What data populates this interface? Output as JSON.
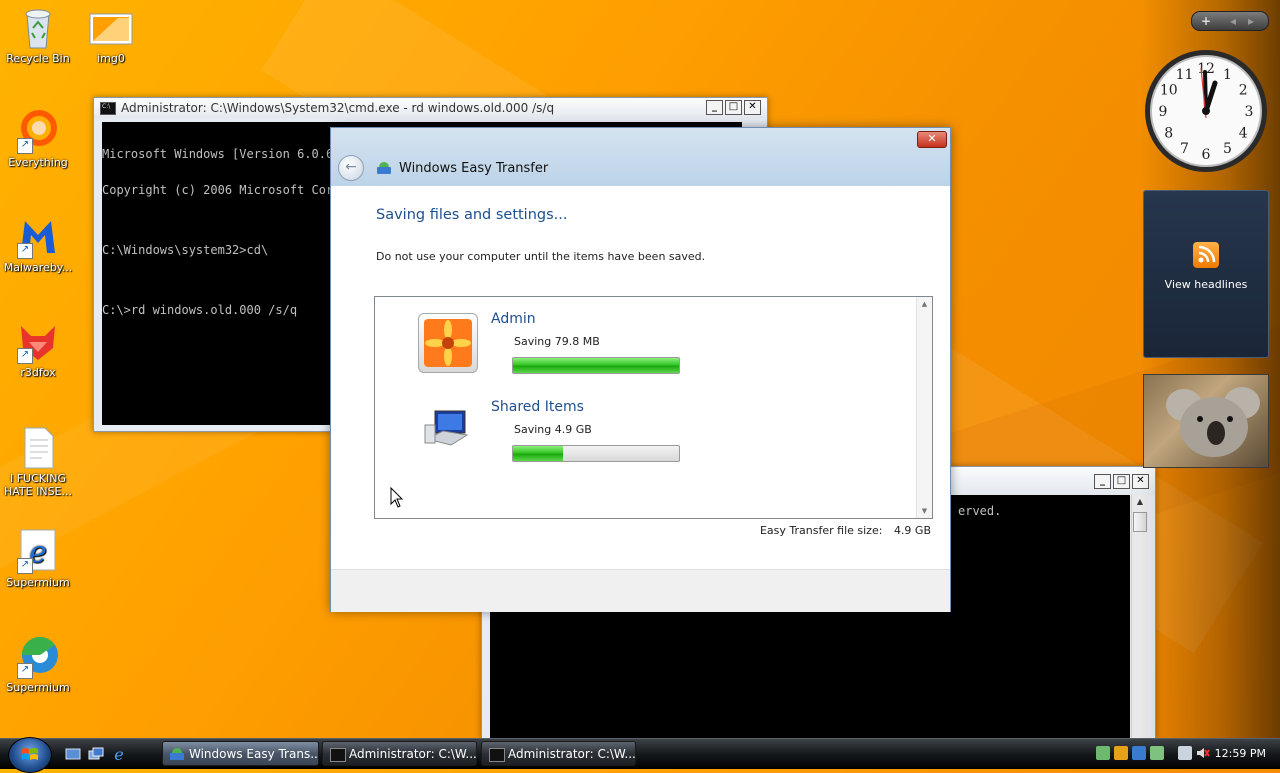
{
  "desktop": {
    "icons": [
      {
        "label": "Recycle Bin",
        "icon": "recycle-bin-icon"
      },
      {
        "label": "img0",
        "icon": "image-file-icon"
      },
      {
        "label": "Everything",
        "icon": "everything-search-icon"
      },
      {
        "label": "Malwareby...",
        "icon": "malwarebytes-icon"
      },
      {
        "label": "r3dfox",
        "icon": "r3dfox-browser-icon"
      },
      {
        "label": "I FUCKING HATE INSE...",
        "icon": "text-document-icon"
      },
      {
        "label": "Supermium",
        "icon": "internet-explorer-icon"
      },
      {
        "label": "Supermium",
        "icon": "supermium-browser-icon"
      }
    ]
  },
  "cmd1": {
    "title": "Administrator: C:\\Windows\\System32\\cmd.exe - rd  windows.old.000 /s/q",
    "lines": [
      "Microsoft Windows [Version 6.0.6002]",
      "Copyright (c) 2006 Microsoft Corporation.",
      "",
      "C:\\Windows\\system32>cd\\",
      "",
      "C:\\>rd windows.old.000 /s/q"
    ]
  },
  "cmd2": {
    "visible_text": "erved."
  },
  "dialog": {
    "title": "Windows Easy Transfer",
    "close_label": "✕",
    "back_label": "←",
    "heading": "Saving files and settings...",
    "instruction": "Do not use your computer until the items have been saved.",
    "items": [
      {
        "name": "Admin",
        "status": "Saving 79.8 MB",
        "progress": 1.0,
        "icon": "user-account-picture-icon"
      },
      {
        "name": "Shared Items",
        "status": "Saving 4.9 GB",
        "progress": 0.3,
        "icon": "shared-computer-icon"
      }
    ],
    "file_size_label": "Easy Transfer file size:",
    "file_size_value": "4.9 GB"
  },
  "gadgets": {
    "feed_label": "View headlines",
    "clock_numbers": [
      "12",
      "1",
      "2",
      "3",
      "4",
      "5",
      "6",
      "7",
      "8",
      "9",
      "10",
      "11"
    ],
    "controls": [
      "+",
      "◂",
      "▸"
    ]
  },
  "taskbar": {
    "tasks": [
      {
        "label": "Windows Easy Trans...",
        "icon": "easy-transfer-icon",
        "active": true
      },
      {
        "label": "Administrator: C:\\W...",
        "icon": "cmd-icon",
        "active": false
      },
      {
        "label": "Administrator: C:\\W...",
        "icon": "cmd-icon",
        "active": false
      }
    ],
    "clock": "12:59 PM"
  },
  "colors": {
    "desktop": "#ffa000",
    "heading": "#1e4f8e",
    "progress": "#36c628"
  }
}
